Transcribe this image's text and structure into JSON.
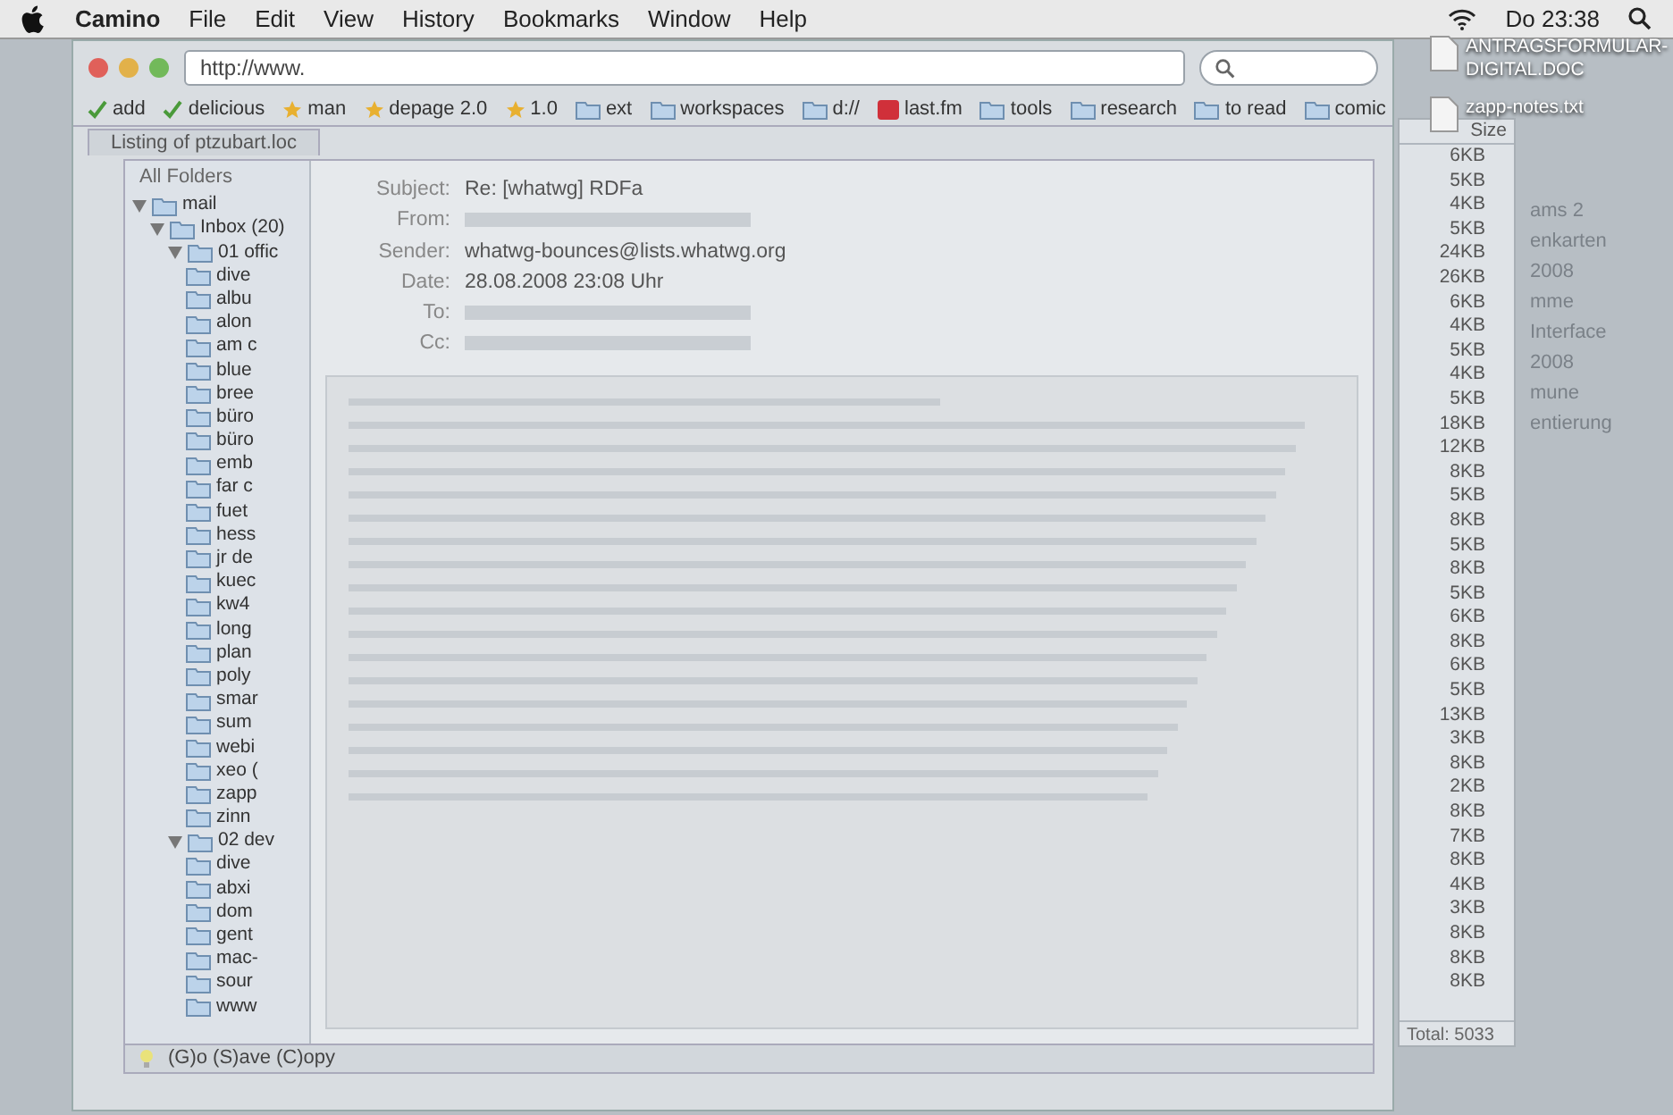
{
  "menu_bar": {
    "app": "Camino",
    "items": [
      "File",
      "Edit",
      "View",
      "History",
      "Bookmarks",
      "Window",
      "Help"
    ],
    "clock": "Do 23:38"
  },
  "browser": {
    "url": "http://www.",
    "bookmarks": [
      {
        "label": "add",
        "kind": "check"
      },
      {
        "label": "delicious",
        "kind": "check"
      },
      {
        "label": "man",
        "kind": "star"
      },
      {
        "label": "depage 2.0",
        "kind": "star"
      },
      {
        "label": "1.0",
        "kind": "star"
      },
      {
        "label": "ext",
        "kind": "folder"
      },
      {
        "label": "workspaces",
        "kind": "folder"
      },
      {
        "label": "d://",
        "kind": "folder"
      },
      {
        "label": "last.fm",
        "kind": "site"
      },
      {
        "label": "tools",
        "kind": "folder"
      },
      {
        "label": "research",
        "kind": "folder"
      },
      {
        "label": "to read",
        "kind": "folder"
      },
      {
        "label": "comic",
        "kind": "folder"
      }
    ],
    "tab": "Listing of ptzubart.loc"
  },
  "mail": {
    "folders_title": "All Folders",
    "folders": [
      {
        "label": "mail",
        "expanded": true,
        "children": [
          {
            "label": "Inbox (20)",
            "expanded": true,
            "children": [
              {
                "label": "01 offic",
                "expanded": true,
                "children": [
                  {
                    "label": "dive"
                  },
                  {
                    "label": "albu"
                  },
                  {
                    "label": "alon"
                  },
                  {
                    "label": "am c"
                  },
                  {
                    "label": "blue"
                  },
                  {
                    "label": "bree"
                  },
                  {
                    "label": "büro"
                  },
                  {
                    "label": "büro"
                  },
                  {
                    "label": "emb"
                  },
                  {
                    "label": "far c"
                  },
                  {
                    "label": "fuet"
                  },
                  {
                    "label": "hess"
                  },
                  {
                    "label": "jr de"
                  },
                  {
                    "label": "kuec"
                  },
                  {
                    "label": "kw4"
                  },
                  {
                    "label": "long"
                  },
                  {
                    "label": "plan"
                  },
                  {
                    "label": "poly"
                  },
                  {
                    "label": "smar"
                  },
                  {
                    "label": "sum"
                  },
                  {
                    "label": "webi"
                  },
                  {
                    "label": "xeo ("
                  },
                  {
                    "label": "zapp"
                  },
                  {
                    "label": "zinn"
                  }
                ]
              },
              {
                "label": "02 dev",
                "expanded": true,
                "children": [
                  {
                    "label": "dive"
                  },
                  {
                    "label": "abxi"
                  },
                  {
                    "label": "dom"
                  },
                  {
                    "label": "gent"
                  },
                  {
                    "label": "mac-"
                  },
                  {
                    "label": "sour"
                  },
                  {
                    "label": "www"
                  }
                ]
              }
            ]
          }
        ]
      }
    ],
    "header": [
      {
        "label": "Subject:",
        "value": "Re: [whatwg] RDFa"
      },
      {
        "label": "From:"
      },
      {
        "label": "Sender:",
        "value": "whatwg-bounces@lists.whatwg.org"
      },
      {
        "label": "Date:",
        "value": "28.08.2008 23:08 Uhr"
      },
      {
        "label": "To:"
      },
      {
        "label": "Cc:"
      }
    ],
    "status": "(G)o (S)ave (C)opy"
  },
  "file_list": {
    "column": "Size",
    "sizes": [
      "6KB",
      "5KB",
      "4KB",
      "5KB",
      "24KB",
      "26KB",
      "6KB",
      "4KB",
      "5KB",
      "4KB",
      "5KB",
      "18KB",
      "12KB",
      "8KB",
      "5KB",
      "8KB",
      "5KB",
      "8KB",
      "5KB",
      "6KB",
      "8KB",
      "6KB",
      "5KB",
      "13KB",
      "3KB",
      "8KB",
      "2KB",
      "8KB",
      "7KB",
      "8KB",
      "4KB",
      "3KB",
      "8KB",
      "8KB",
      "8KB"
    ],
    "total": "Total: 5033"
  },
  "side_texts": [
    "ams 2",
    "enkarten",
    "2008",
    "mme",
    "Interface",
    "2008",
    "mune",
    "entierung"
  ],
  "desktop_icons": [
    {
      "label": "ANTRAGSFORMULAR-DIGITAL.DOC"
    },
    {
      "label": "zapp-notes.txt"
    }
  ]
}
